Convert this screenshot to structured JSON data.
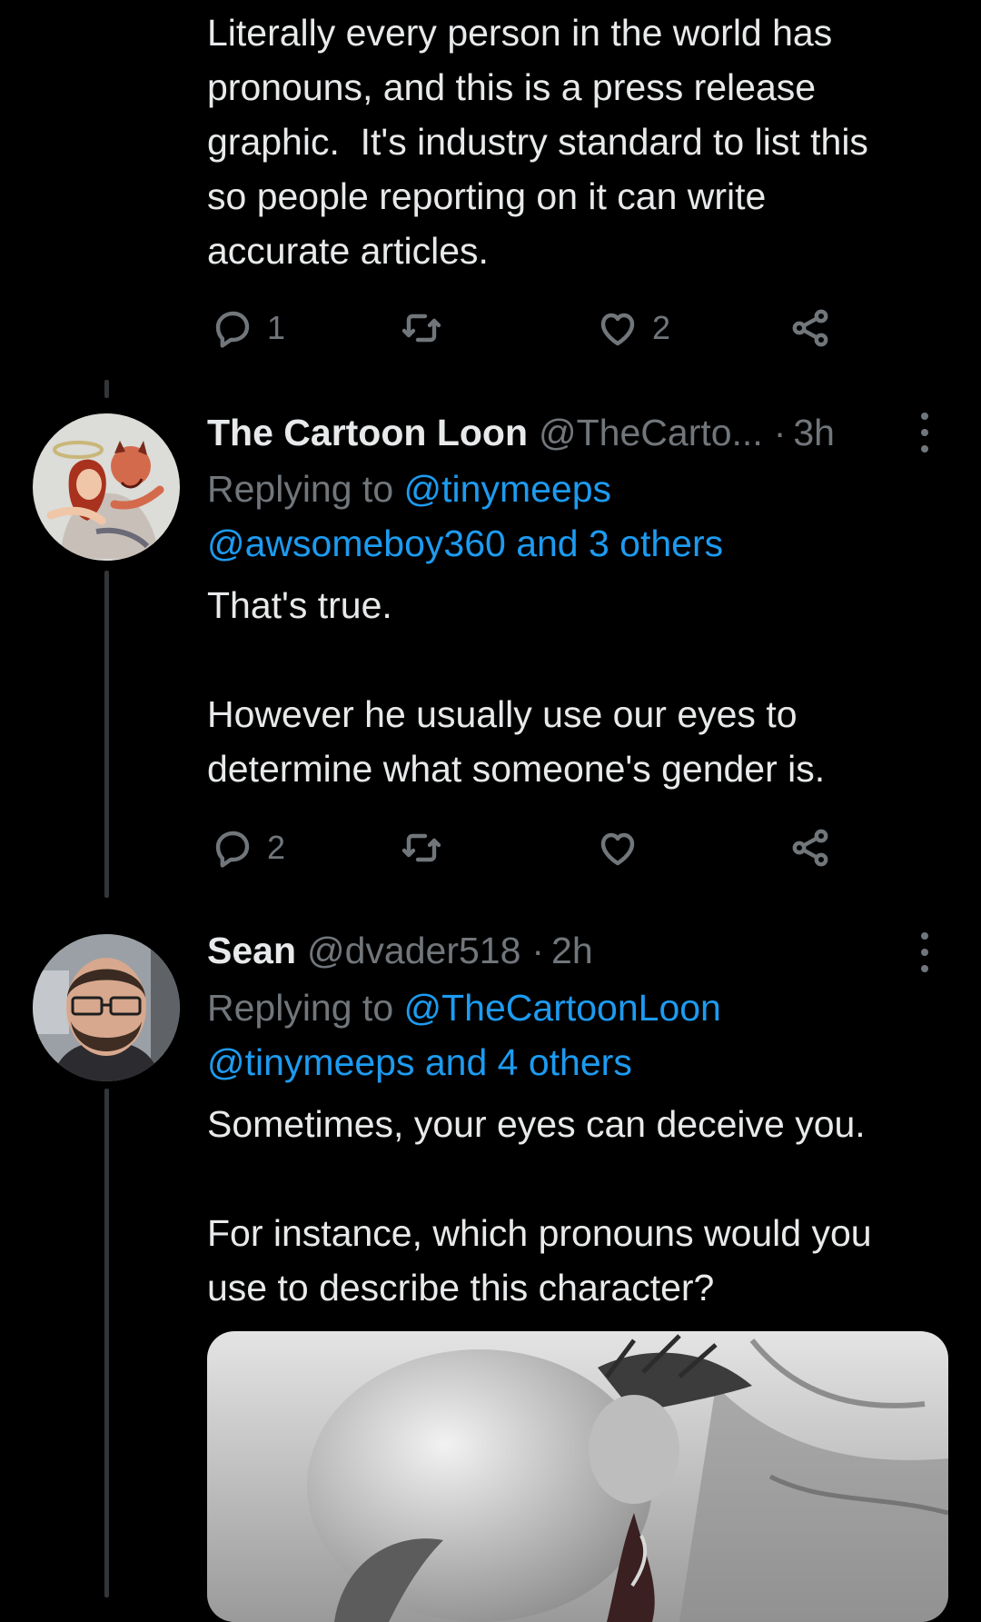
{
  "tweet1": {
    "text": "Literally every person in the world has\npronouns, and this is a press release\ngraphic.  It's industry standard to list this\nso people reporting on it can write\naccurate articles.",
    "actions": {
      "reply_count": "1",
      "retweet_count": "",
      "like_count": "2"
    }
  },
  "tweet2": {
    "name": "The Cartoon Loon",
    "handle": "@TheCarto...",
    "dot": "·",
    "time": "3h",
    "replying_prefix": "Replying to ",
    "replying_first": "@tinymeeps",
    "replying_rest": "@awsomeboy360 and 3 others",
    "text": "That's true.\n\nHowever he usually use our eyes to\ndetermine what someone's gender is.",
    "actions": {
      "reply_count": "2",
      "retweet_count": "",
      "like_count": ""
    }
  },
  "tweet3": {
    "name": "Sean",
    "handle": "@dvader518",
    "dot": "·",
    "time": "2h",
    "replying_prefix": "Replying to ",
    "replying_first": "@TheCartoonLoon",
    "replying_rest": "@tinymeeps and 4 others",
    "text": "Sometimes, your eyes can deceive you.\n\nFor instance, which pronouns would you\nuse to describe this character?"
  },
  "colors": {
    "background": "#000000",
    "text": "#e7e9ea",
    "muted": "#71767b",
    "link": "#1d9bf0",
    "thread_line": "#333639"
  },
  "icons": [
    "reply-icon",
    "retweet-icon",
    "like-icon",
    "share-icon",
    "more-icon"
  ]
}
